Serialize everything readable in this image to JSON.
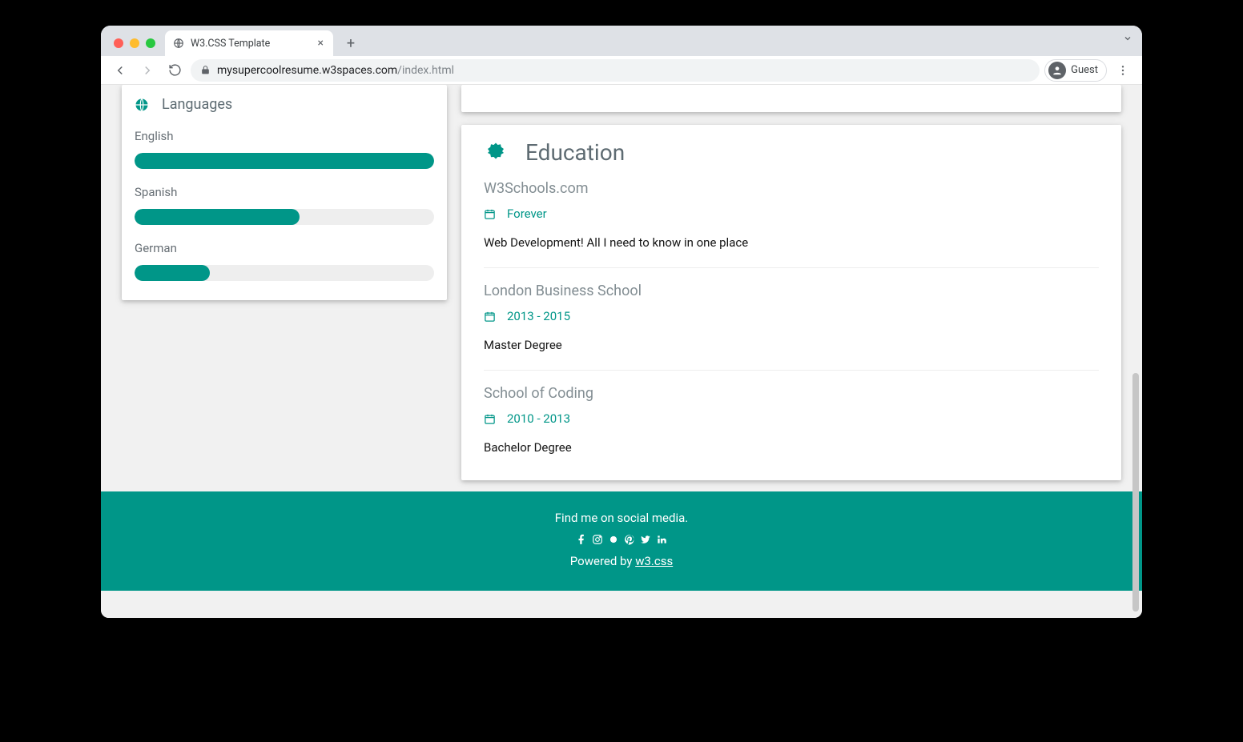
{
  "browser": {
    "tab_title": "W3.CSS Template",
    "url_host": "mysupercoolresume.w3spaces.com",
    "url_path": "/index.html",
    "profile_label": "Guest"
  },
  "sidebar": {
    "languages_heading": "Languages",
    "languages": [
      {
        "name": "English",
        "percent": 100
      },
      {
        "name": "Spanish",
        "percent": 55
      },
      {
        "name": "German",
        "percent": 25
      }
    ]
  },
  "education": {
    "heading": "Education",
    "entries": [
      {
        "school": "W3Schools.com",
        "dates": "Forever",
        "desc": "Web Development! All I need to know in one place"
      },
      {
        "school": "London Business School",
        "dates": "2013 - 2015",
        "desc": "Master Degree"
      },
      {
        "school": "School of Coding",
        "dates": "2010 - 2013",
        "desc": "Bachelor Degree"
      }
    ]
  },
  "footer": {
    "find_me": "Find me on social media.",
    "powered_prefix": "Powered by ",
    "powered_link": "w3.css"
  }
}
